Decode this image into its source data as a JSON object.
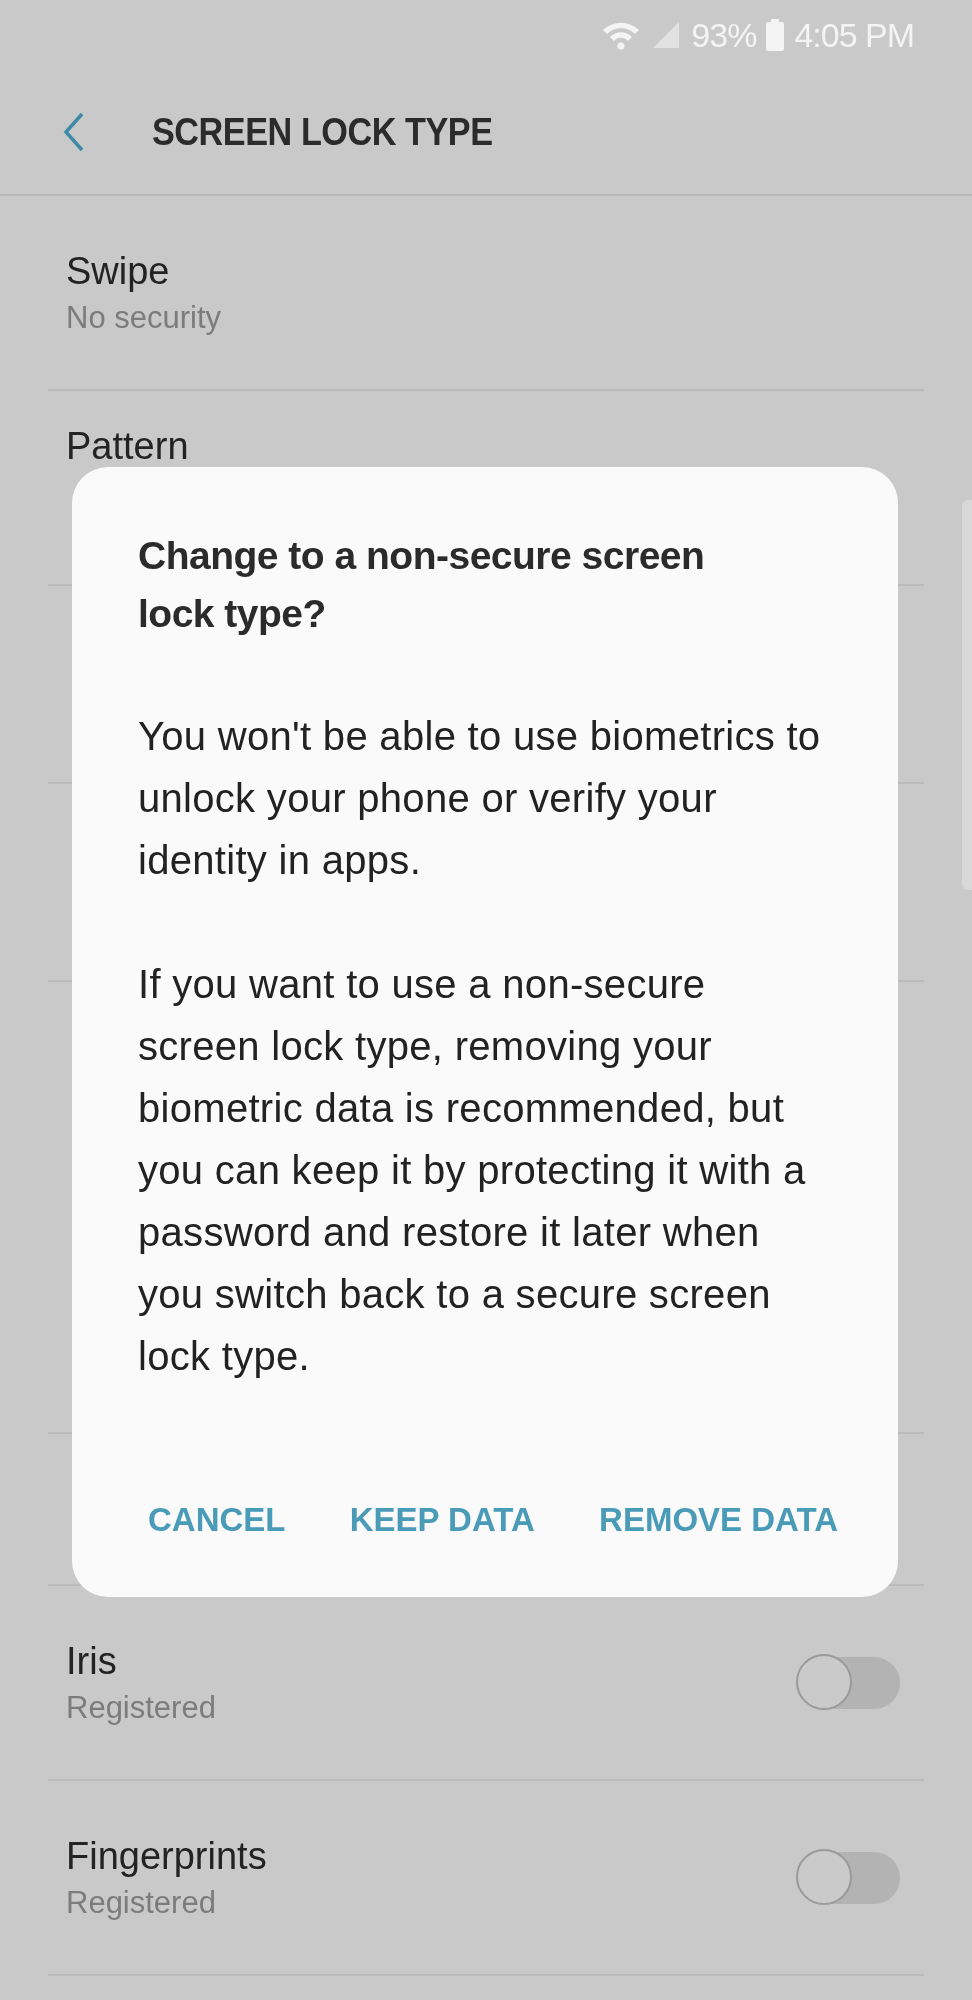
{
  "status_bar": {
    "battery": "93%",
    "time": "4:05 PM"
  },
  "header": {
    "title": "SCREEN LOCK TYPE"
  },
  "options": [
    {
      "title": "Swipe",
      "subtitle": "No security"
    },
    {
      "title": "Pattern"
    }
  ],
  "biometrics": [
    {
      "title": "Iris",
      "subtitle": "Registered",
      "on": false
    },
    {
      "title": "Fingerprints",
      "subtitle": "Registered",
      "on": false
    }
  ],
  "dialog": {
    "title": "Change to a non-secure screen lock type?",
    "paragraphs": [
      "You won't be able to use biometrics to unlock your phone or verify your identity in apps.",
      "If you want to use a non-secure screen lock type, removing your biometric data is recommended, but you can keep it by protecting it with a password and restore it later when you switch back to a secure screen lock type."
    ],
    "buttons": [
      "CANCEL",
      "KEEP DATA",
      "REMOVE DATA"
    ]
  }
}
